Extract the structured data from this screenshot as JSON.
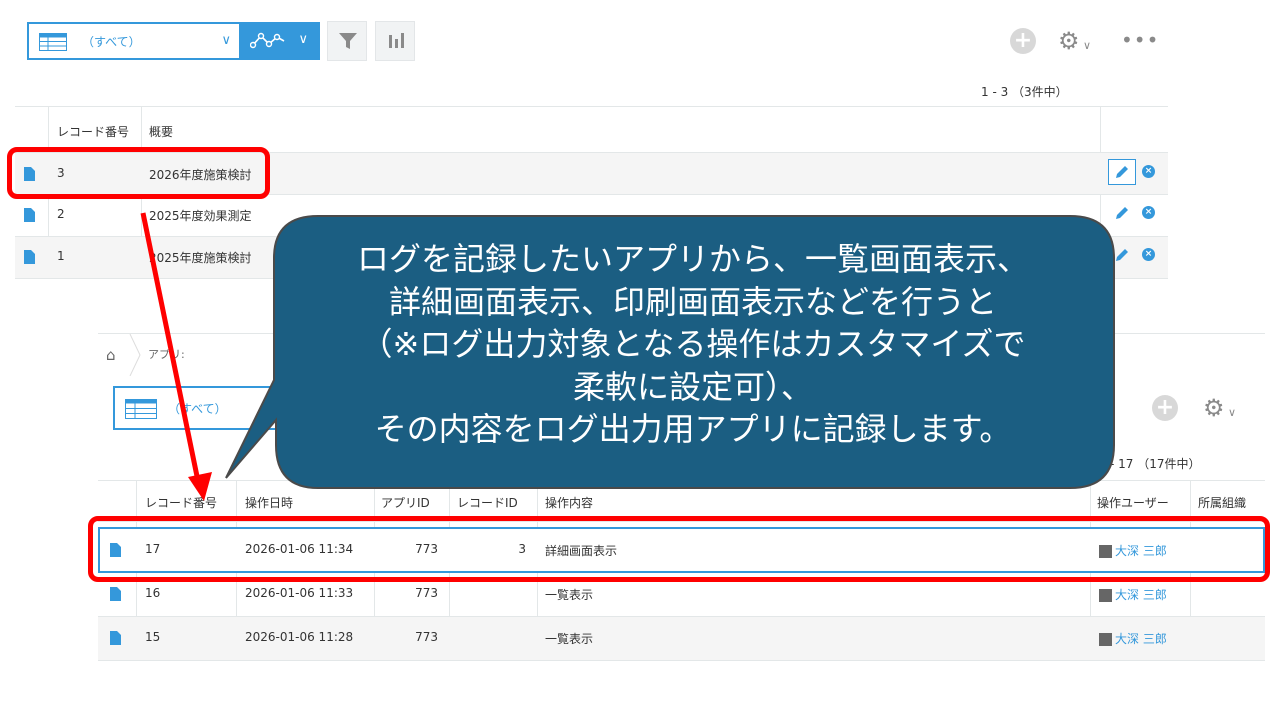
{
  "toolbar": {
    "view_label": "（すべて）",
    "pager": "1 - 3 （3件中）"
  },
  "table1": {
    "headers": [
      "レコード番号",
      "概要"
    ],
    "rows": [
      {
        "record_no": "3",
        "summary": "2026年度施策検討"
      },
      {
        "record_no": "2",
        "summary": "2025年度効果測定"
      },
      {
        "record_no": "1",
        "summary": "2025年度施策検討"
      }
    ]
  },
  "screen2": {
    "breadcrumb": "アプリ:",
    "view_label": "（すべて）",
    "pager": "- 17 （17件中）",
    "headers": [
      "レコード番号",
      "操作日時",
      "アプリID",
      "レコードID",
      "操作内容",
      "操作ユーザー",
      "所属組織"
    ],
    "rows": [
      {
        "record_no": "17",
        "datetime": "2026-01-06 11:34",
        "app_id": "773",
        "record_id": "3",
        "operation": "詳細画面表示",
        "user": "大深 三郎",
        "org": ""
      },
      {
        "record_no": "16",
        "datetime": "2026-01-06 11:33",
        "app_id": "773",
        "record_id": "",
        "operation": "一覧表示",
        "user": "大深 三郎",
        "org": ""
      },
      {
        "record_no": "15",
        "datetime": "2026-01-06 11:28",
        "app_id": "773",
        "record_id": "",
        "operation": "一覧表示",
        "user": "大深 三郎",
        "org": ""
      }
    ]
  },
  "callout": {
    "lines": [
      "ログを記録したいアプリから、一覧画面表示、",
      "詳細画面表示、印刷画面表示などを行うと",
      "（※ログ出力対象となる操作はカスタマイズで",
      "柔軟に設定可）、",
      "その内容をログ出力用アプリに記録します。"
    ]
  },
  "colors": {
    "accent": "#3498db",
    "annotation_red": "#ff0000",
    "callout_fill": "#1b5e82",
    "callout_border": "#4a4a4a"
  },
  "icons": [
    "grid-icon",
    "graph-icon",
    "filter-icon",
    "bar-chart-icon",
    "plus-icon",
    "gear-icon",
    "more-icon",
    "document-icon",
    "pencil-icon",
    "close-icon",
    "home-icon",
    "user-icon"
  ]
}
